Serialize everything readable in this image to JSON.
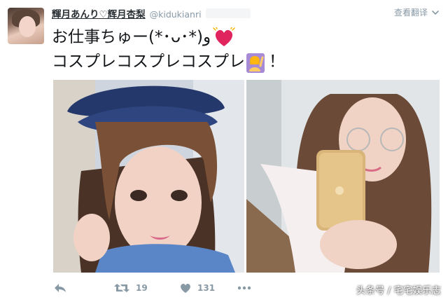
{
  "tweet": {
    "author": {
      "display_name": "輝月あんり♡辉月杏梨",
      "handle": "@kidukianri"
    },
    "translate_label": "查看翻译",
    "text_line1": "お仕事ちゅー(*･ᴗ･*)و",
    "text_line2": "コスプレコスプレコスプレ",
    "text_line2_suffix": "！",
    "emoji": [
      "heart-emoji",
      "person-raising-hand-emoji"
    ],
    "photos": [
      {
        "subject": "woman-in-police-costume"
      },
      {
        "subject": "woman-taking-mirror-selfie"
      }
    ]
  },
  "actions": {
    "reply_icon": "reply-icon",
    "retweet_icon": "retweet-icon",
    "retweet_count": "19",
    "like_icon": "heart-icon",
    "like_count": "131",
    "more_icon": "more-icon"
  },
  "watermark": "头条号 / 宅宅娱乐志",
  "colors": {
    "muted": "#8899a6",
    "text": "#14171a",
    "heart_emoji": "#e0245e"
  }
}
